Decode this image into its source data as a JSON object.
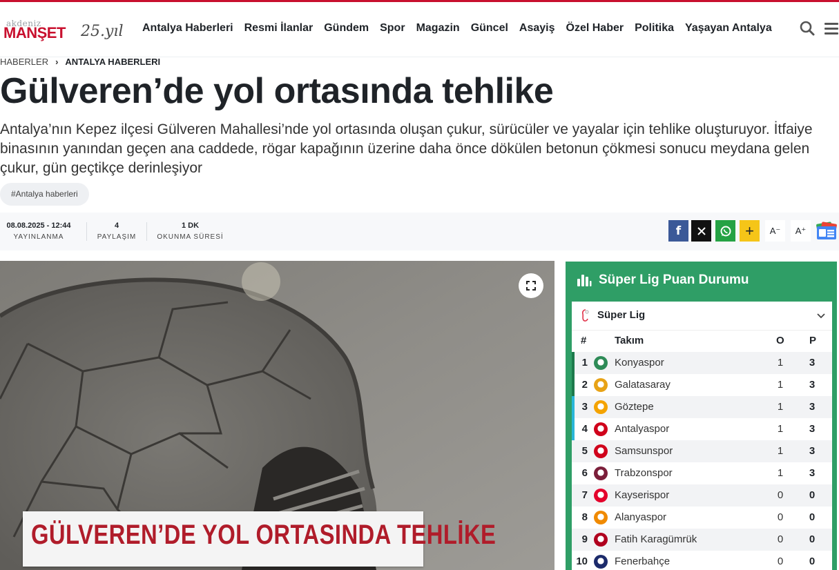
{
  "header": {
    "logo": {
      "small": "akdeniz",
      "brand": "MANŞET",
      "script": "25.yıl"
    },
    "nav": [
      "Antalya Haberleri",
      "Resmi İlanlar",
      "Gündem",
      "Spor",
      "Magazin",
      "Güncel",
      "Asayiş",
      "Özel Haber",
      "Politika",
      "Yaşayan Antalya"
    ],
    "icons": {
      "search": "search-icon",
      "menu": "hamburger-menu-icon"
    }
  },
  "breadcrumb": {
    "root": "HABERLER",
    "current": "ANTALYA HABERLERI"
  },
  "article": {
    "title": "Gülveren’de yol ortasında tehlike",
    "summary": "Antalya’nın Kepez ilçesi Gülveren Mahallesi’nde yol ortasında oluşan çukur, sürücüler ve yayalar için tehlike oluşturuyor. İtfaiye binasının yanından geçen ana caddede, rögar kapağının üzerine daha önce dökülen betonun çökmesi sonucu meydana gelen çukur, gün geçtikçe derinleşiyor",
    "tag": "#Antalya haberleri",
    "image_caption": "GÜLVEREN’DE YOL ORTASINDA TEHLİKE"
  },
  "meta": [
    {
      "value": "08.08.2025 - 12:44",
      "label": "YAYINLANMA"
    },
    {
      "value": "4",
      "label": "PAYLAŞIM"
    },
    {
      "value": "1 DK",
      "label": "OKUNMA SÜRESİ"
    }
  ],
  "share": {
    "plus": "+",
    "font_smaller": "A⁻",
    "font_larger": "A⁺",
    "colors": {
      "facebook": "#3b5998",
      "x": "#111111",
      "whatsapp": "#25a244",
      "plus": "#f5c518"
    }
  },
  "standings": {
    "title": "Süper Lig Puan Durumu",
    "league": "Süper Lig",
    "columns": {
      "rank": "#",
      "team": "Takım",
      "played": "O",
      "points": "P"
    },
    "rows": [
      {
        "rank": "1",
        "team": "Konyaspor",
        "played": "1",
        "points": "3",
        "zone_color": "#1d7a4c",
        "crest_color": "#2e8b57"
      },
      {
        "rank": "2",
        "team": "Galatasaray",
        "played": "1",
        "points": "3",
        "zone_color": "#1d7a4c",
        "crest_color": "#e8a317"
      },
      {
        "rank": "3",
        "team": "Göztepe",
        "played": "1",
        "points": "3",
        "zone_color": "#29b6d8",
        "crest_color": "#f4a300"
      },
      {
        "rank": "4",
        "team": "Antalyaspor",
        "played": "1",
        "points": "3",
        "zone_color": "#29b6d8",
        "crest_color": "#d0021b"
      },
      {
        "rank": "5",
        "team": "Samsunspor",
        "played": "1",
        "points": "3",
        "zone_color": "",
        "crest_color": "#d0021b"
      },
      {
        "rank": "6",
        "team": "Trabzonspor",
        "played": "1",
        "points": "3",
        "zone_color": "",
        "crest_color": "#7b1e3a"
      },
      {
        "rank": "7",
        "team": "Kayserispor",
        "played": "0",
        "points": "0",
        "zone_color": "",
        "crest_color": "#e4002b"
      },
      {
        "rank": "8",
        "team": "Alanyaspor",
        "played": "0",
        "points": "0",
        "zone_color": "",
        "crest_color": "#f08a00"
      },
      {
        "rank": "9",
        "team": "Fatih Karagümrük",
        "played": "0",
        "points": "0",
        "zone_color": "",
        "crest_color": "#b0001e"
      },
      {
        "rank": "10",
        "team": "Fenerbahçe",
        "played": "0",
        "points": "0",
        "zone_color": "",
        "crest_color": "#1c2b6b"
      }
    ]
  },
  "colors": {
    "brand_red": "#c8102e",
    "widget_green": "#2f9e66",
    "caption_red": "#b01c2a"
  }
}
